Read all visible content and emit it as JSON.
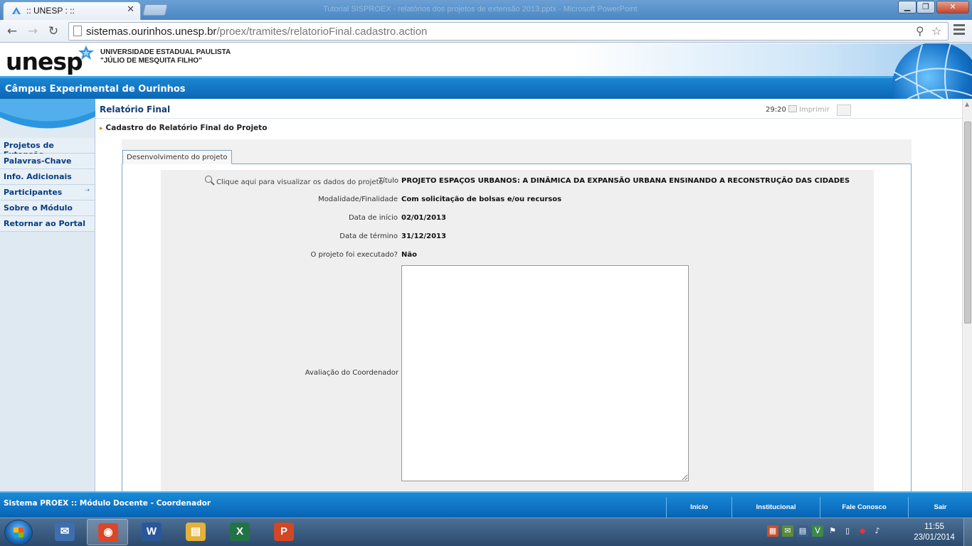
{
  "browser": {
    "tab_title": ":: UNESP : ::",
    "window_title": "Tutorial SISPROEX - relatórios dos projetos de extensão 2013.pptx - Microsoft PowerPoint",
    "url_host": "sistemas.ourinhos.unesp.br",
    "url_path": "/proex/tramites/relatorioFinal.cadastro.action"
  },
  "header": {
    "logo": "unesp",
    "university_line1": "UNIVERSIDADE ESTADUAL PAULISTA",
    "university_line2": "\"JÚLIO DE MESQUITA FILHO\"",
    "campus": "Câmpus Experimental de Ourinhos"
  },
  "sidebar": {
    "items": [
      {
        "label": "Projetos de Extensão"
      },
      {
        "label": "Palavras-Chave"
      },
      {
        "label": "Info. Adicionais"
      },
      {
        "label": "Participantes",
        "has_submenu": true
      },
      {
        "label": "Sobre o Módulo"
      },
      {
        "label": "Retornar ao Portal"
      }
    ]
  },
  "content": {
    "title": "Relatório Final",
    "timer": "29:20",
    "print_label": "Imprimir",
    "breadcrumb": "Cadastro do Relatório Final do Projeto",
    "tab_label": "Desenvolvimento do projeto"
  },
  "form": {
    "lookup_link": "Clique aqui para visualizar os dados do projeto",
    "fields": [
      {
        "label": "Título",
        "value": "PROJETO ESPAÇOS URBANOS: A DINÂMICA DA EXPANSÃO URBANA ENSINANDO A RECONSTRUÇÃO DAS CIDADES"
      },
      {
        "label": "Modalidade/Finalidade",
        "value": "Com solicitação de bolsas e/ou recursos"
      },
      {
        "label": "Data de início",
        "value": "02/01/2013"
      },
      {
        "label": "Data de término",
        "value": "31/12/2013"
      },
      {
        "label": "O projeto foi executado?",
        "value": "Não"
      }
    ],
    "evaluation_label": "Avaliação do Coordenador",
    "evaluation_value": ""
  },
  "footer": {
    "system_text": "Sistema PROEX :: Módulo Docente - Coordenador",
    "links": [
      {
        "label": "Início"
      },
      {
        "label": "Institucional"
      },
      {
        "label": "Fale Conosco"
      },
      {
        "label": "Sair"
      }
    ]
  },
  "taskbar": {
    "apps": [
      {
        "name": "thunderbird-icon",
        "color": "#3d6fb0",
        "glyph": "✉"
      },
      {
        "name": "chrome-icon",
        "color": "#d9472b",
        "glyph": "◉",
        "active": true
      },
      {
        "name": "word-icon",
        "color": "#2b579a",
        "glyph": "W"
      },
      {
        "name": "explorer-icon",
        "color": "#e2b23a",
        "glyph": "▤"
      },
      {
        "name": "excel-icon",
        "color": "#217346",
        "glyph": "X"
      },
      {
        "name": "powerpoint-icon",
        "color": "#d24726",
        "glyph": "P"
      }
    ],
    "time": "11:55",
    "date": "23/01/2014"
  },
  "colors": {
    "brand_blue": "#0a64b4",
    "nav_text": "#0a3d82",
    "breadcrumb_bullet": "#e07810"
  }
}
